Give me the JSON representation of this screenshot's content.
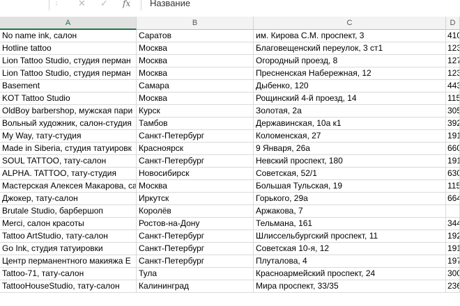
{
  "formula_bar": {
    "cancel_icon": "✕",
    "enter_icon": "✓",
    "fx_label": "fx",
    "formula_value": "Название"
  },
  "columns": [
    "A",
    "B",
    "C",
    "D"
  ],
  "rows": [
    {
      "a": "No name ink, салон",
      "b": "Саратов",
      "c": "им. Кирова С.М. проспект, 3",
      "d": "410"
    },
    {
      "a": "Hotline tattoo",
      "b": "Москва",
      "c": "Благовещенский переулок, 3 ст1",
      "d": "123"
    },
    {
      "a": "Lion Tattoo Studio, студия перман",
      "b": "Москва",
      "c": "Огородный проезд, 8",
      "d": "127"
    },
    {
      "a": "Lion Tattoo Studio, студия перман",
      "b": "Москва",
      "c": "Пресненская Набережная, 12",
      "d": "123"
    },
    {
      "a": "Basement",
      "b": "Самара",
      "c": "Дыбенко, 120",
      "d": "443"
    },
    {
      "a": "KOT Tattoo Studio",
      "b": "Москва",
      "c": "Рощинский 4-й проезд, 14",
      "d": "115"
    },
    {
      "a": "OldBoy barbershop, мужская пари",
      "b": "Курск",
      "c": "Золотая, 2а",
      "d": "305"
    },
    {
      "a": "Вольный художник, салон-студия",
      "b": "Тамбов",
      "c": "Державинская, 10а к1",
      "d": "392"
    },
    {
      "a": "My Way, тату-студия",
      "b": "Санкт-Петербург",
      "c": "Коломенская, 27",
      "d": "191"
    },
    {
      "a": "Made in Siberia, студия татуировк",
      "b": "Красноярск",
      "c": "9 Января, 26а",
      "d": "660"
    },
    {
      "a": "SOUL TATTOO, тату-салон",
      "b": "Санкт-Петербург",
      "c": "Невский проспект, 180",
      "d": "191"
    },
    {
      "a": "ALPHA. TATTOO, тату-студия",
      "b": "Новосибирск",
      "c": "Советская, 52/1",
      "d": "630"
    },
    {
      "a": "Мастерская Алексея Макарова, са",
      "b": "Москва",
      "c": "Большая Тульская, 19",
      "d": "115"
    },
    {
      "a": "Джокер, тату-салон",
      "b": "Иркутск",
      "c": "Горького, 29а",
      "d": "664"
    },
    {
      "a": "Brutale Studio, барбершоп",
      "b": "Королёв",
      "c": "Аржакова, 7",
      "d": ""
    },
    {
      "a": "Merci, салон красоты",
      "b": "Ростов-на-Дону",
      "c": "Тельмана, 161",
      "d": "344"
    },
    {
      "a": "Tattoo ArtStudio, тату-салон",
      "b": "Санкт-Петербург",
      "c": "Шлиссельбургский проспект, 11",
      "d": "192"
    },
    {
      "a": "Go Ink, студия татуировки",
      "b": "Санкт-Петербург",
      "c": "Советская 10-я, 12",
      "d": "191"
    },
    {
      "a": "Центр перманентного макияжа Е",
      "b": "Санкт-Петербург",
      "c": "Плуталова, 4",
      "d": "197"
    },
    {
      "a": "Tattoo-71, тату-салон",
      "b": "Тула",
      "c": "Красноармейский проспект, 24",
      "d": "300"
    },
    {
      "a": "TattooHouseStudio, тату-салон",
      "b": "Калининград",
      "c": "Мира проспект, 33/35",
      "d": "236"
    }
  ]
}
